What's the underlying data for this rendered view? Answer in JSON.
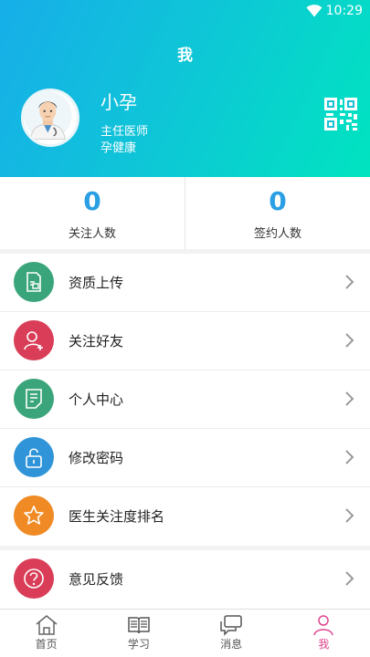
{
  "status": {
    "time": "10:29"
  },
  "header": {
    "title": "我"
  },
  "profile": {
    "name": "小孕",
    "title": "主任医师",
    "org": "孕健康"
  },
  "stats": [
    {
      "value": "0",
      "label": "关注人数"
    },
    {
      "value": "0",
      "label": "签约人数"
    }
  ],
  "menu": [
    {
      "label": "资质上传",
      "icon": "document-upload-icon",
      "color": "#3aa57a"
    },
    {
      "label": "关注好友",
      "icon": "add-friend-icon",
      "color": "#d93d57"
    },
    {
      "label": "个人中心",
      "icon": "notepad-icon",
      "color": "#3aa57a"
    },
    {
      "label": "修改密码",
      "icon": "unlock-icon",
      "color": "#2f95d8"
    },
    {
      "label": "医生关注度排名",
      "icon": "star-icon",
      "color": "#f08a24"
    },
    {
      "label": "意见反馈",
      "icon": "question-icon",
      "color": "#d93d57"
    }
  ],
  "tabs": [
    {
      "label": "首页",
      "icon": "home-icon"
    },
    {
      "label": "学习",
      "icon": "book-icon"
    },
    {
      "label": "消息",
      "icon": "chat-icon"
    },
    {
      "label": "我",
      "icon": "person-icon",
      "active": true
    }
  ],
  "colors": {
    "accent": "#2a9fe3",
    "active_tab": "#e0458e"
  }
}
